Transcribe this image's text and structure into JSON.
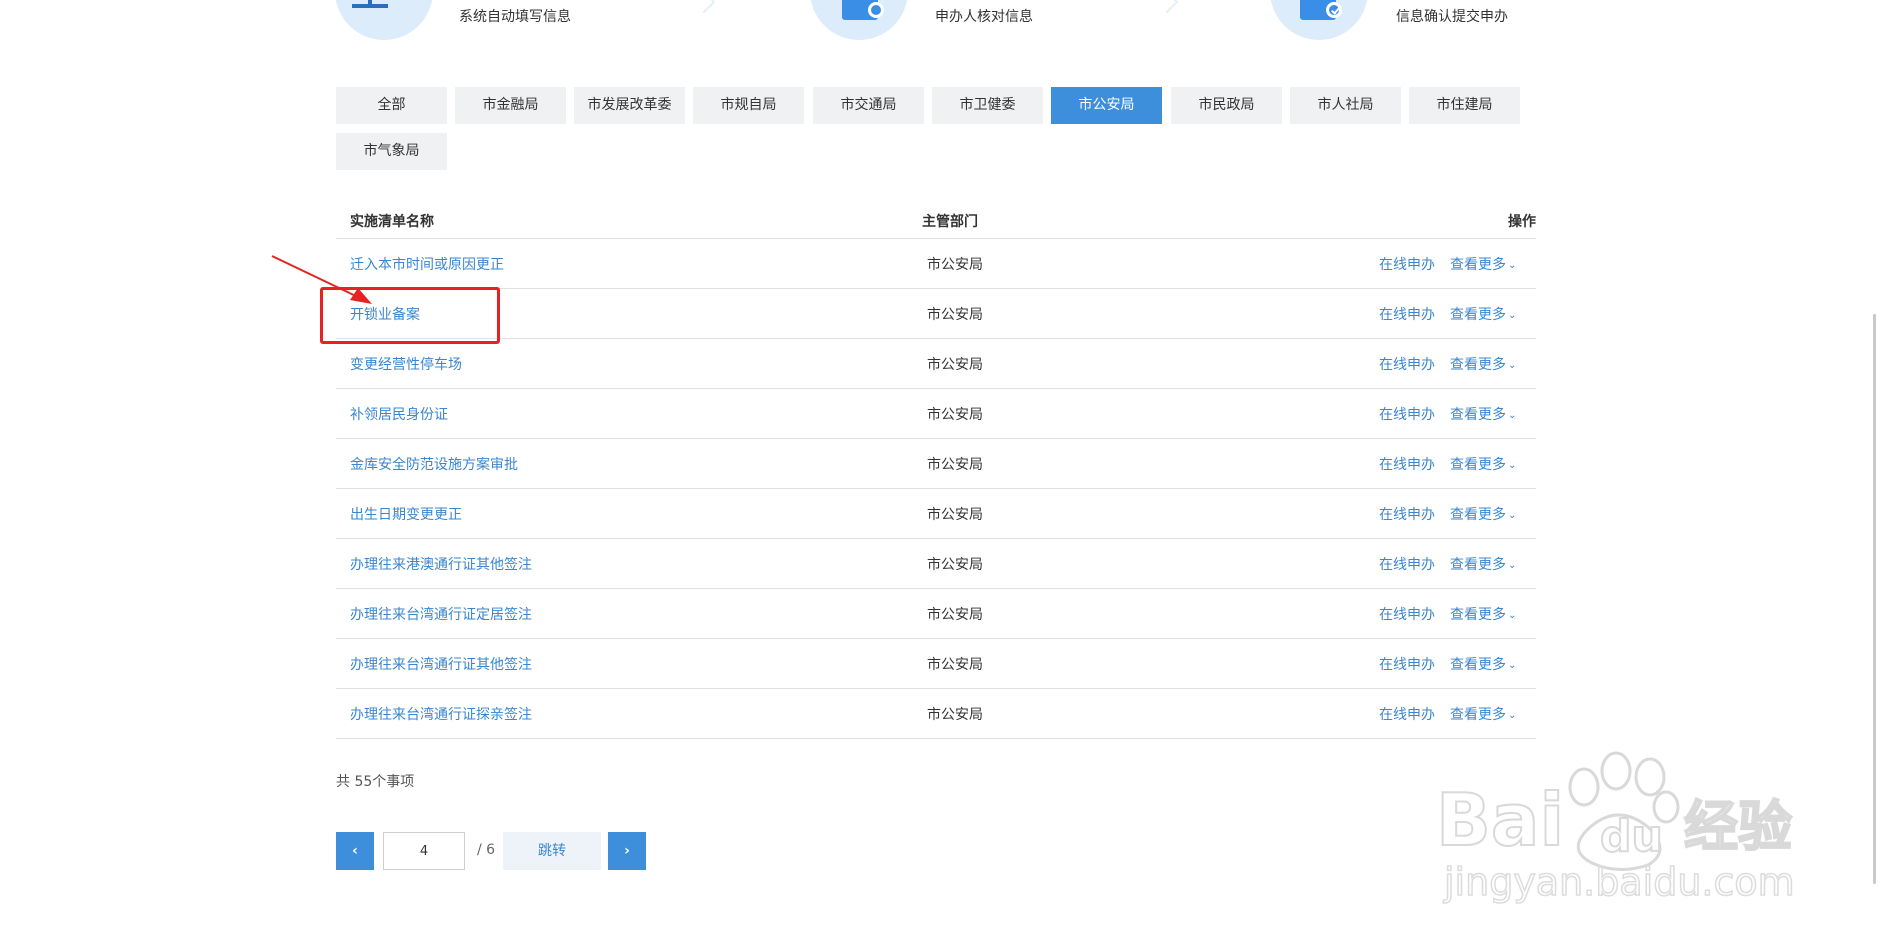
{
  "steps": [
    {
      "label": "系统自动填写信息",
      "icon": "monitor-icon"
    },
    {
      "label": "申办人核对信息",
      "icon": "document-shield-icon"
    },
    {
      "label": "信息确认提交申办",
      "icon": "document-check-icon"
    }
  ],
  "tabs": [
    {
      "label": "全部",
      "active": false
    },
    {
      "label": "市金融局",
      "active": false
    },
    {
      "label": "市发展改革委",
      "active": false
    },
    {
      "label": "市规自局",
      "active": false
    },
    {
      "label": "市交通局",
      "active": false
    },
    {
      "label": "市卫健委",
      "active": false
    },
    {
      "label": "市公安局",
      "active": true
    },
    {
      "label": "市民政局",
      "active": false
    },
    {
      "label": "市人社局",
      "active": false
    },
    {
      "label": "市住建局",
      "active": false
    },
    {
      "label": "市气象局",
      "active": false
    }
  ],
  "table": {
    "headers": {
      "name": "实施清单名称",
      "dept": "主管部门",
      "op": "操作"
    },
    "rows": [
      {
        "name": "迁入本市时间或原因更正",
        "dept": "市公安局",
        "apply": "在线申办",
        "more": "查看更多"
      },
      {
        "name": "开锁业备案",
        "dept": "市公安局",
        "apply": "在线申办",
        "more": "查看更多"
      },
      {
        "name": "变更经营性停车场",
        "dept": "市公安局",
        "apply": "在线申办",
        "more": "查看更多"
      },
      {
        "name": "补领居民身份证",
        "dept": "市公安局",
        "apply": "在线申办",
        "more": "查看更多"
      },
      {
        "name": "金库安全防范设施方案审批",
        "dept": "市公安局",
        "apply": "在线申办",
        "more": "查看更多"
      },
      {
        "name": "出生日期变更更正",
        "dept": "市公安局",
        "apply": "在线申办",
        "more": "查看更多"
      },
      {
        "name": "办理往来港澳通行证其他签注",
        "dept": "市公安局",
        "apply": "在线申办",
        "more": "查看更多"
      },
      {
        "name": "办理往来台湾通行证定居签注",
        "dept": "市公安局",
        "apply": "在线申办",
        "more": "查看更多"
      },
      {
        "name": "办理往来台湾通行证其他签注",
        "dept": "市公安局",
        "apply": "在线申办",
        "more": "查看更多"
      },
      {
        "name": "办理往来台湾通行证探亲签注",
        "dept": "市公安局",
        "apply": "在线申办",
        "more": "查看更多"
      }
    ]
  },
  "summary": {
    "total_text": "共 55个事项"
  },
  "pager": {
    "prev": "‹",
    "current": "4",
    "total": "/ 6",
    "jump": "跳转",
    "next": "›"
  },
  "watermark": {
    "line1": "Bai",
    "line1b": "du",
    "line1c": "经验",
    "line2": "jingyan.baidu.com"
  },
  "colors": {
    "accent": "#3d8fdb",
    "link": "#3a86cf",
    "annotation": "#e62222",
    "tab_bg": "#f0f1f3"
  }
}
